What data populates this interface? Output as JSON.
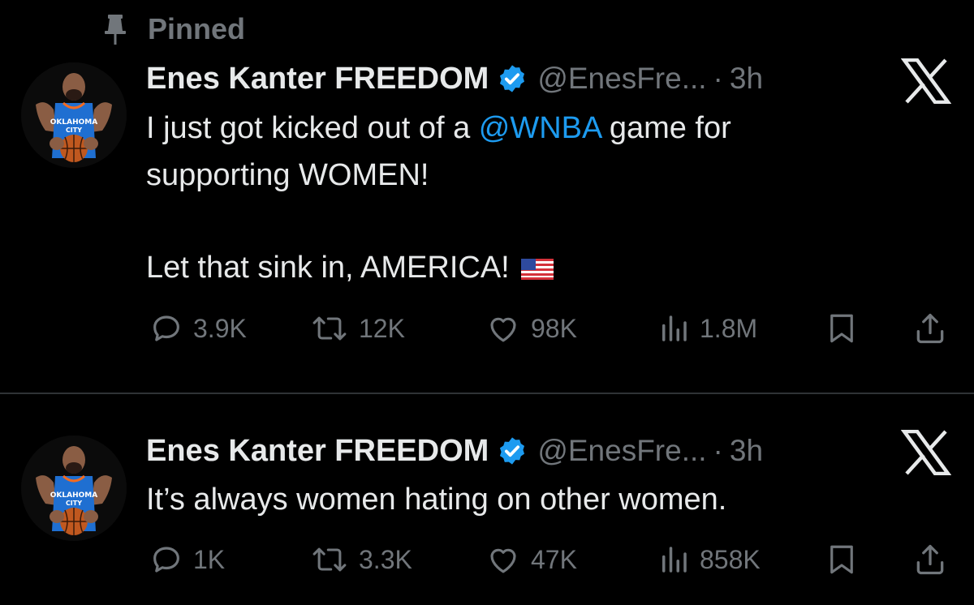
{
  "pinned": {
    "label": "Pinned"
  },
  "tweets": [
    {
      "author": {
        "name": "Enes Kanter FREEDOM",
        "handle": "@EnesFre...",
        "separator": "·",
        "time": "3h",
        "verified": true,
        "avatar_jersey_text": [
          "OKLAHOMA",
          "CITY"
        ]
      },
      "text": {
        "line1_before": "I just got kicked out of a ",
        "mention": "@WNBA",
        "line1_after": " game for",
        "line2": "supporting WOMEN!",
        "line3": "Let that sink in, AMERICA!",
        "emoji": "us-flag"
      },
      "stats": {
        "replies": "3.9K",
        "retweets": "12K",
        "likes": "98K",
        "views": "1.8M"
      }
    },
    {
      "author": {
        "name": "Enes Kanter FREEDOM",
        "handle": "@EnesFre...",
        "separator": "·",
        "time": "3h",
        "verified": true,
        "avatar_jersey_text": [
          "OKLAHOMA",
          "CITY"
        ]
      },
      "text": {
        "line1": "It’s always women hating on other women."
      },
      "stats": {
        "replies": "1K",
        "retweets": "3.3K",
        "likes": "47K",
        "views": "858K"
      }
    }
  ],
  "icons": {
    "pin": "pin-icon",
    "verified": "verified-badge-icon",
    "platform": "x-logo-icon",
    "reply": "reply-icon",
    "retweet": "retweet-icon",
    "like": "heart-icon",
    "views": "views-icon",
    "bookmark": "bookmark-icon",
    "share": "share-icon"
  },
  "colors": {
    "background": "#000000",
    "text_primary": "#e7e9ea",
    "text_secondary": "#71767b",
    "link": "#1d9bf0",
    "verified": "#1d9bf0",
    "divider": "#2f3336"
  }
}
